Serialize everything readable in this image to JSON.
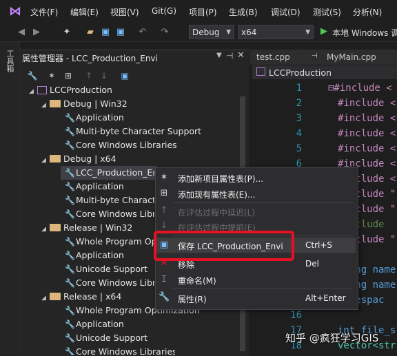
{
  "menubar": {
    "items": [
      "文件(F)",
      "编辑(E)",
      "视图(V)",
      "Git(G)",
      "项目(P)",
      "生成(B)",
      "调试(D)",
      "测试(S)",
      "分析(N)"
    ]
  },
  "toolbar": {
    "config": "Debug",
    "platform": "x64",
    "run_label": "本地 Windows 调"
  },
  "sidebar": {
    "toolbox_label": "工具箱"
  },
  "property_manager": {
    "title": "属性管理器 - LCC_Production_Envi",
    "tree": {
      "root": "LCCProduction",
      "debug_win32": "Debug | Win32",
      "dw_items": [
        "Application",
        "Multi-byte Character Support",
        "Core Windows Libraries"
      ],
      "debug_x64": "Debug | x64",
      "dx_items": [
        "LCC_Production_Envi",
        "Application",
        "Multi-byte Character Support",
        "Core Windows Libraries"
      ],
      "release_win32": "Release | Win32",
      "rw_items": [
        "Whole Program Optimization",
        "Application",
        "Unicode Support",
        "Core Windows Libraries"
      ],
      "release_x64": "Release | x64",
      "rx_items": [
        "Whole Program Optimization",
        "Application",
        "Unicode Support",
        "Core Windows Libraries"
      ]
    }
  },
  "editor": {
    "tabs": [
      "test.cpp",
      "MyMain.cpp"
    ],
    "project": "LCCProduction",
    "line_numbers": [
      "1",
      "2",
      "3",
      "4",
      "5",
      "6",
      "7",
      "8",
      "9",
      "10",
      "11",
      "12",
      "13",
      "14",
      "15",
      "16",
      "17",
      "18"
    ],
    "lines": [
      "⊟#include <",
      "#include <",
      "#include <",
      "#include <",
      "#include <",
      "#include <",
      "#include <",
      "#include \"",
      "#include \"",
      "#include",
      "#include \"",
      "",
      "using name",
      "using name",
      "namespac",
      "",
      "int file_s",
      "vector<str"
    ]
  },
  "context_menu": {
    "items": {
      "add_new": "添加新项目属性表(P)...",
      "add_existing": "添加现有属性表(E)...",
      "defer": "在评估过程中延迟(L)",
      "promote": "在评估过程中提前(E)",
      "save": "保存 LCC_Production_Envi",
      "save_shortcut": "Ctrl+S",
      "remove": "移除",
      "remove_shortcut": "Del",
      "rename": "重命名(M)",
      "properties": "属性(R)",
      "properties_shortcut": "Alt+Enter"
    }
  },
  "watermark": "知乎 @疯狂学习GIS"
}
